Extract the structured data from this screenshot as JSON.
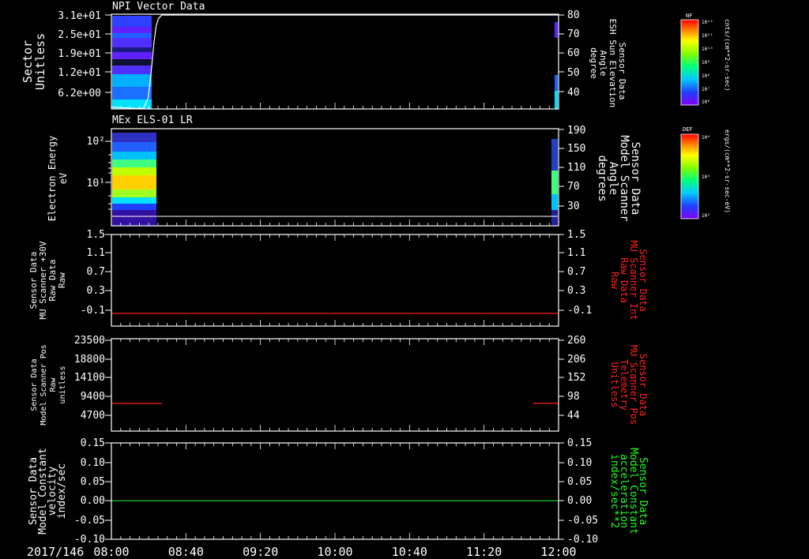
{
  "chart_data": [
    {
      "type": "heatmap",
      "title": "NPI Vector Data",
      "ylabel": [
        "Sector",
        "Unitless"
      ],
      "y_ticks": [
        "3.1e+01",
        "2.5e+01",
        "1.9e+01",
        "1.2e+01",
        "6.2e+00"
      ],
      "right_label": [
        "Sensor Data",
        "ESH Sun Elevation",
        "Angle",
        "degree"
      ],
      "right_ticks": [
        "80",
        "70",
        "60",
        "50",
        "40"
      ],
      "right_range": [
        30,
        80
      ],
      "colorbar": {
        "label": "NF",
        "unit": "cnts/(cm**2-sr-sec)",
        "ticks": [
          "10¹²",
          "10¹¹",
          "10¹⁰",
          "10⁹",
          "10⁸",
          "10⁷",
          "10⁶"
        ]
      },
      "overlay_line": {
        "x": [
          8.0,
          8.15,
          8.25,
          8.29,
          8.33,
          8.36,
          8.38,
          8.4,
          8.42,
          8.45,
          8.5,
          8.75,
          11.6,
          12.0
        ],
        "y": [
          31,
          30.5,
          30.2,
          30.5,
          36,
          52,
          65,
          74,
          78,
          80,
          80,
          80,
          80,
          80
        ]
      }
    },
    {
      "type": "heatmap",
      "title": "MEx ELS-01 LR",
      "ylabel": [
        "Electron Energy",
        "eV"
      ],
      "y_ticks": [
        "10²",
        "10¹"
      ],
      "right_label": [
        "Sensor Data",
        "Model Scanner",
        "Angle",
        "degrees"
      ],
      "right_ticks": [
        "190",
        "150",
        "110",
        "70",
        "30"
      ],
      "right_range": [
        0,
        190
      ],
      "colorbar": {
        "label": "DEF",
        "unit": "ergs/(cm**2-sr-sec-eV)",
        "ticks": [
          "10⁴",
          "10³",
          "10²"
        ]
      },
      "overlay_line": {
        "x": [
          8.0,
          12.0
        ],
        "y": [
          8,
          8
        ]
      }
    },
    {
      "type": "line",
      "ylabel": [
        "Sensor Data",
        "MU Scanner +30V",
        "Raw Data",
        "Raw"
      ],
      "y_ticks": [
        "1.5",
        "1.1",
        "0.7",
        "0.3",
        "-0.1"
      ],
      "ylim": [
        -0.3,
        1.5
      ],
      "right_label": [
        "Sensor Data",
        "MU Scanner Int",
        "Raw Data",
        "Raw"
      ],
      "right_ticks": [
        "1.5",
        "1.1",
        "0.7",
        "0.3",
        "-0.1"
      ],
      "series": [
        {
          "color": "#ff2020",
          "x": [
            8.0,
            12.0
          ],
          "y": [
            -0.05,
            -0.05
          ]
        }
      ]
    },
    {
      "type": "line",
      "ylabel": [
        "Sensor Data",
        "Model Scanner Pos",
        "Raw",
        "unitless"
      ],
      "y_ticks": [
        "23500",
        "18800",
        "14100",
        "9400",
        "4700"
      ],
      "ylim": [
        0,
        23500
      ],
      "right_label": [
        "Sensor Data",
        "MU Scanner Pos",
        "Telemetry",
        "Unitless"
      ],
      "right_ticks": [
        "260",
        "206",
        "152",
        "98",
        "44"
      ],
      "series": [
        {
          "color": "#ff2020",
          "x": [
            8.0,
            8.45
          ],
          "y": [
            7050,
            7050
          ]
        },
        {
          "color": "#ff2020",
          "x": [
            11.77,
            12.0
          ],
          "y": [
            7050,
            7050
          ]
        }
      ]
    },
    {
      "type": "line",
      "ylabel": [
        "Sensor Data",
        "Model Constant",
        "velocity",
        "index/sec"
      ],
      "y_ticks": [
        "0.15",
        "0.10",
        "0.05",
        "0.00",
        "-0.05",
        "-0.10"
      ],
      "ylim": [
        -0.1,
        0.15
      ],
      "right_label": [
        "Sensor Data",
        "Model Constant",
        "acceleration",
        "index/sec**2"
      ],
      "right_ticks": [
        "0.15",
        "0.10",
        "0.05",
        "0.00",
        "-0.05",
        "-0.10"
      ],
      "series": [
        {
          "color": "#20e020",
          "x": [
            8.0,
            12.0
          ],
          "y": [
            0.0,
            0.0
          ]
        }
      ]
    }
  ],
  "x_axis": {
    "date": "2017/146",
    "ticks": [
      "08:00",
      "08:40",
      "09:20",
      "10:00",
      "10:40",
      "11:20",
      "12:00"
    ],
    "range": [
      "08:00",
      "12:00"
    ]
  }
}
